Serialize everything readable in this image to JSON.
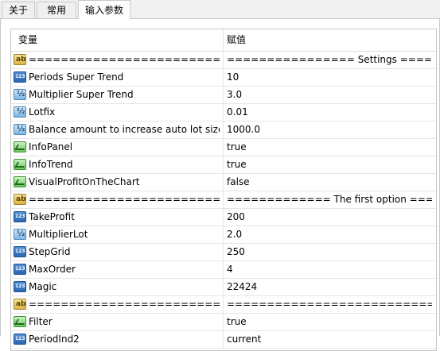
{
  "tabs": [
    {
      "label": "关于",
      "active": false
    },
    {
      "label": "常用",
      "active": false
    },
    {
      "label": "输入参数",
      "active": true
    }
  ],
  "table": {
    "columns": [
      "变量",
      "赋值"
    ],
    "rows": [
      {
        "icon": "string-icon",
        "name": "========================",
        "value": "================ Settings ================"
      },
      {
        "icon": "integer-icon",
        "name": "Periods Super Trend",
        "value": "10"
      },
      {
        "icon": "double-icon",
        "name": "Multiplier Super Trend",
        "value": "3.0"
      },
      {
        "icon": "double-icon",
        "name": "Lotfix",
        "value": "0.01"
      },
      {
        "icon": "double-icon",
        "name": "Balance amount to increase auto lot size",
        "value": "1000.0"
      },
      {
        "icon": "bool-icon",
        "name": "InfoPanel",
        "value": "true"
      },
      {
        "icon": "bool-icon",
        "name": "InfoTrend",
        "value": "true"
      },
      {
        "icon": "bool-icon",
        "name": "VisualProfitOnTheChart",
        "value": "false"
      },
      {
        "icon": "string-icon",
        "name": "========================",
        "value": "============= The first option ============="
      },
      {
        "icon": "integer-icon",
        "name": "TakeProfit",
        "value": "200"
      },
      {
        "icon": "double-icon",
        "name": "MultiplierLot",
        "value": "2.0"
      },
      {
        "icon": "integer-icon",
        "name": "StepGrid",
        "value": "250"
      },
      {
        "icon": "integer-icon",
        "name": "MaxOrder",
        "value": "4"
      },
      {
        "icon": "integer-icon",
        "name": "Magic",
        "value": "22424"
      },
      {
        "icon": "string-icon",
        "name": "========================",
        "value": "==================================="
      },
      {
        "icon": "bool-icon",
        "name": "Filter",
        "value": "true"
      },
      {
        "icon": "integer-icon",
        "name": "PeriodInd2",
        "value": "current"
      }
    ]
  }
}
